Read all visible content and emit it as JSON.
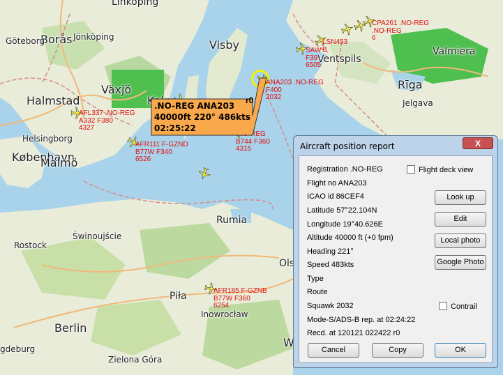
{
  "map": {
    "cities": {
      "linkoping": "Linköping",
      "boras": "Borås",
      "goteborg": "Göteborg",
      "jonkoping": "Jönköping",
      "visby": "Visby",
      "valmiera": "Valmiera",
      "ventspils": "Ventspils",
      "riga": "Rīga",
      "halmstad": "Halmstad",
      "vaxjo": "Växjö",
      "kalmar": "Kalm",
      "jelgava": "Jelgava",
      "helsingborg": "Helsingborg",
      "kobenhavn": "København",
      "malmo": "Malmö",
      "rumia": "Rumia",
      "rostock": "Rostock",
      "swinoujscie": "Świnoujście",
      "olsztyn": "Ols",
      "pila": "Piła",
      "inowroclaw": "Inowrocław",
      "berlin": "Berlin",
      "magdeburg": "gdeburg",
      "zielona_gora": "Zielona Góra",
      "w": "W"
    },
    "aircraft": [
      {
        "line1": "AFL337 .NO-REG",
        "line2": "A332 F380",
        "line3": "4327"
      },
      {
        "line1": "AFR111 F-GZND",
        "line2": "B77W F340",
        "line3": "6526"
      },
      {
        "line1": "ANA203 .NO-REG",
        "line2": "F400",
        "line3": "2032"
      },
      {
        "line1": ".NO-REG",
        "line2": "B744 F360",
        "line3": "4315"
      },
      {
        "line1": "AFR185 F-GZNB",
        "line2": "B77W F360",
        "line3": "6254"
      },
      {
        "line1": "SAW",
        "line2": "F39",
        "line3": "6505"
      },
      {
        "line1": "LSN453",
        "line2": "B",
        "line3": ""
      },
      {
        "line1": "CPA261 .NO-REG",
        "line2": ".NO-REG",
        "line3": "6"
      }
    ],
    "tooltip": {
      "line1": ".NO-REG ANA203",
      "line2": "40000ft 220° 486kts",
      "line3": "02:25:22"
    },
    "ro_marker": "r0"
  },
  "dialog": {
    "title": "Aircraft position report",
    "close_label": "X",
    "fields": {
      "registration": "Registration .NO-REG",
      "flight_no": "Flight no ANA203",
      "icao_id": "ICAO id 86CEF4",
      "latitude": "Latitude  57°22.104N",
      "longitude": "Longitude  19°40.626E",
      "altitude": "Altitude 40000 ft (+0 fpm)",
      "heading": "Heading   221°",
      "speed": "Speed   483kts",
      "type": "Type",
      "route": "Route",
      "squawk": "Squawk 2032",
      "mode_s": "Mode-S/ADS-B rep. at 02:24:22",
      "recd": "Recd. at 120121 022422 r0"
    },
    "checkboxes": {
      "flight_deck_view": "Flight deck view",
      "contrail": "Contrail"
    },
    "buttons": {
      "look_up": "Look up",
      "edit": "Edit",
      "local_photo": "Local photo",
      "google_photo": "Google Photo",
      "cancel": "Cancel",
      "copy": "Copy",
      "ok": "OK"
    }
  }
}
